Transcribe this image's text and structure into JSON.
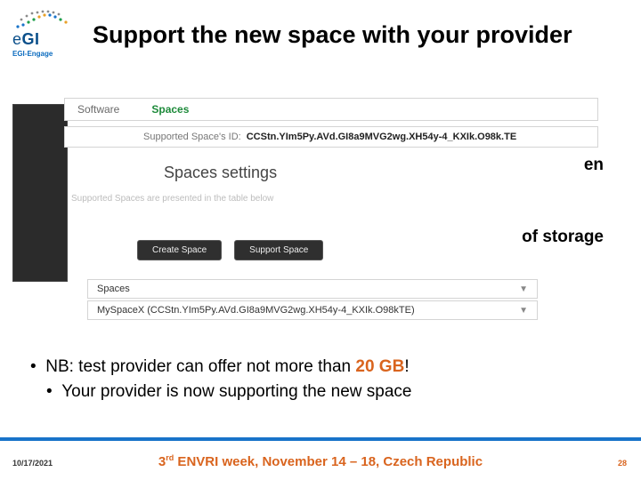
{
  "logo": {
    "main": "eGI",
    "sub": "EGI-Engage"
  },
  "title": "Support the new space with your provider",
  "tabs": {
    "software": "Software",
    "spaces": "Spaces"
  },
  "supported_id": {
    "label": "Supported Space's ID:",
    "value": "CCStn.YIm5Py.AVd.GI8a9MVG2wg.XH54y-4_KXIk.O98k.TE"
  },
  "spaces_settings": "Spaces settings",
  "faint": "Supported Spaces are presented in the table below",
  "side": {
    "en": "en",
    "storage": "of storage"
  },
  "buttons": {
    "create": "Create Space",
    "support": "Support Space"
  },
  "rows": {
    "spaces_header": "Spaces",
    "myspace": "MySpaceX (CCStn.YIm5Py.AVd.GI8a9MVG2wg.XH54y-4_KXIk.O98kTE)"
  },
  "bullets": {
    "l1_a": "NB: test provider can offer not more than ",
    "l1_hl": "20 GB",
    "l1_b": "!",
    "l2": "Your provider is now supporting the new space"
  },
  "footer": {
    "date": "10/17/2021",
    "center_pre": "3",
    "center_sup": "rd",
    "center_rest": " ENVRI week,  November 14 – 18, Czech Republic",
    "page": "28"
  }
}
